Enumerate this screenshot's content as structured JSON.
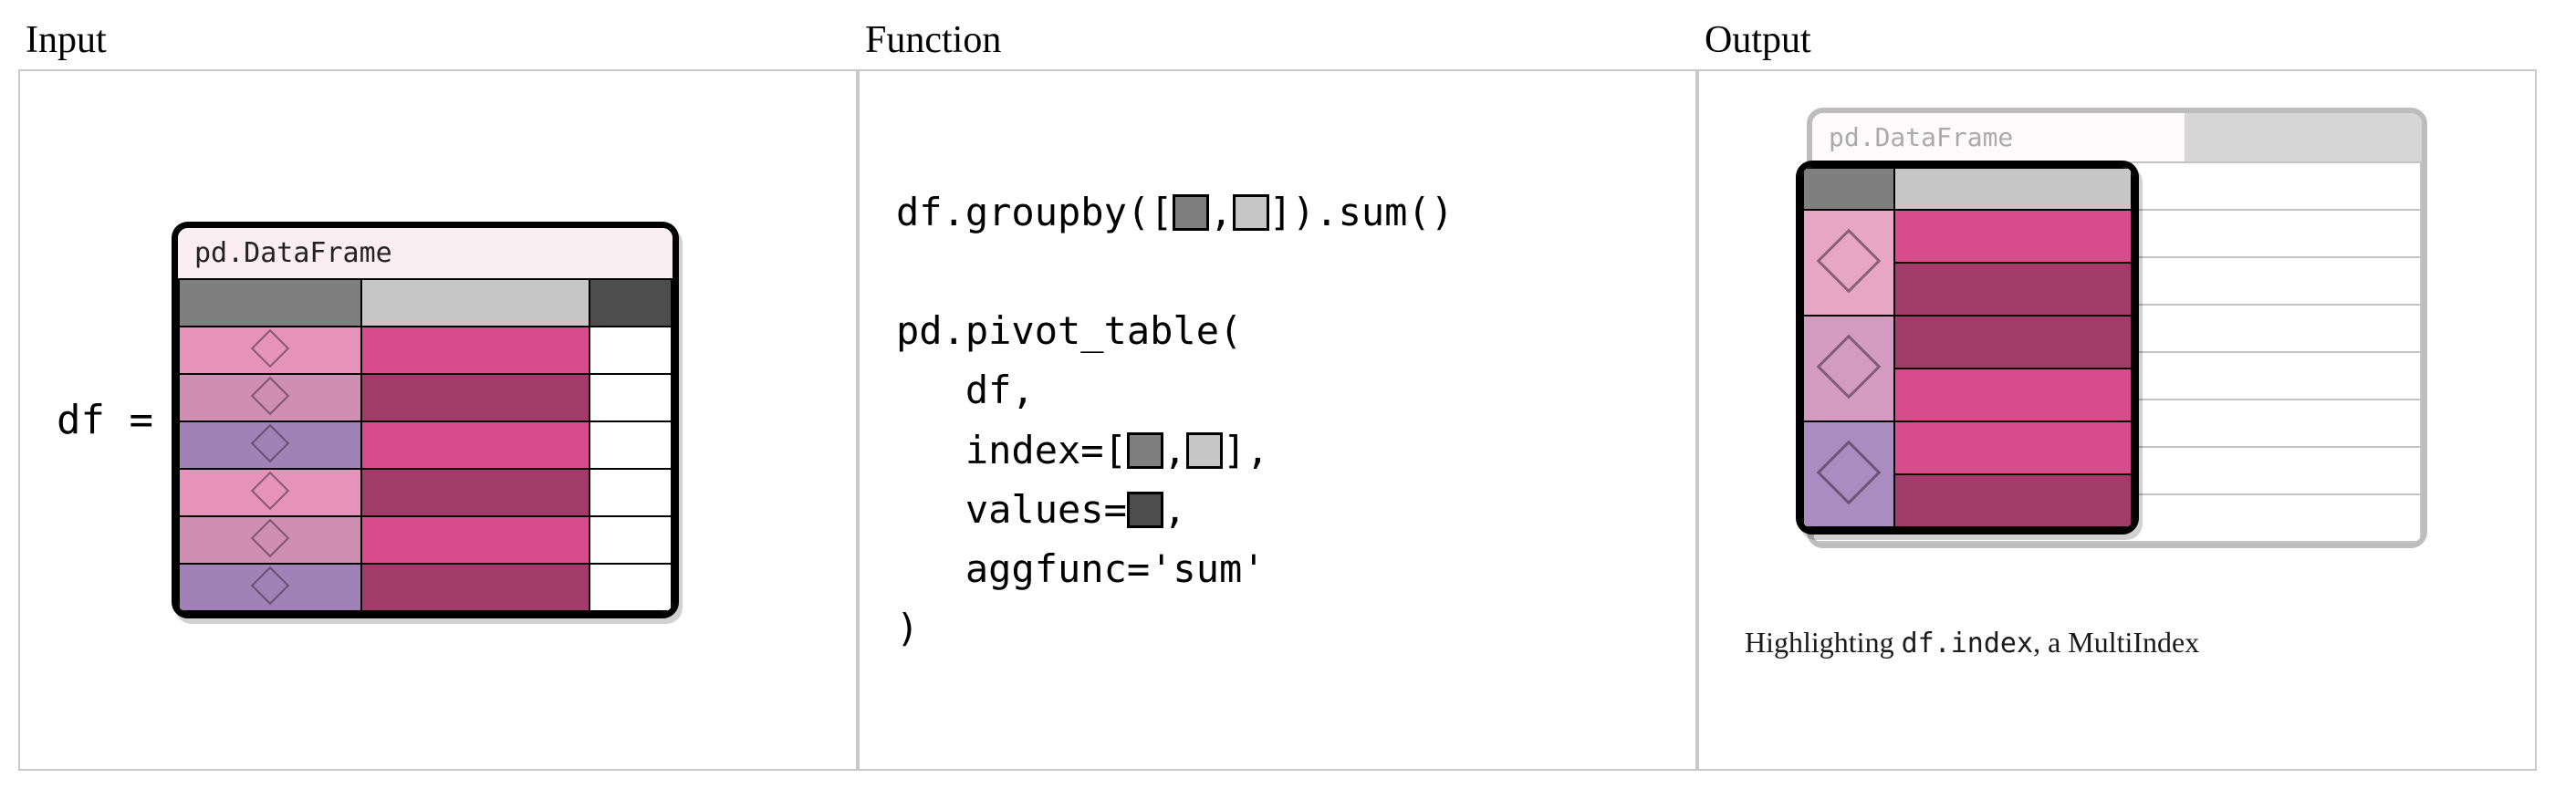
{
  "panels": {
    "input": {
      "label": "Input"
    },
    "function": {
      "label": "Function"
    },
    "output": {
      "label": "Output"
    }
  },
  "input": {
    "assign": "df =",
    "df_title": "pd.DataFrame",
    "header_colors": [
      "#7f7f7f",
      "#c6c6c6",
      "#4d4d4d"
    ],
    "rows": [
      {
        "index_color": "#e693bb",
        "value_color": "#d94c8b"
      },
      {
        "index_color": "#cf8fb3",
        "value_color": "#a23b6a"
      },
      {
        "index_color": "#a082b7",
        "value_color": "#d94c8b"
      },
      {
        "index_color": "#e693bb",
        "value_color": "#a23b6a"
      },
      {
        "index_color": "#cf8fb3",
        "value_color": "#d94c8b"
      },
      {
        "index_color": "#a082b7",
        "value_color": "#a23b6a"
      }
    ]
  },
  "function": {
    "line1_a": "df.groupby([",
    "line1_b": ",",
    "line1_c": "]).sum()",
    "pivot_open": "pd.pivot_table(",
    "arg_df": "   df,",
    "arg_index_a": "   index=[",
    "arg_index_b": ",",
    "arg_index_c": "],",
    "arg_values_a": "   values=",
    "arg_values_b": ",",
    "arg_aggfunc": "   aggfunc='sum'",
    "close": ")",
    "squares": {
      "dark": "#7f7f7f",
      "light": "#c6c6c6",
      "dgrey": "#4d4d4d"
    }
  },
  "output": {
    "ghost_title": "pd.DataFrame",
    "ghost_rows": 7,
    "overlay": {
      "header_colors": [
        "#7f7f7f",
        "#c6c6c6"
      ],
      "groups": [
        {
          "index_color": "#e6a6c4",
          "values": [
            "#d94c8b",
            "#a23b6a"
          ]
        },
        {
          "index_color": "#d39bbf",
          "values": [
            "#a23b6a",
            "#d94c8b"
          ]
        },
        {
          "index_color": "#ab8cc0",
          "values": [
            "#d94c8b",
            "#a23b6a"
          ]
        }
      ]
    },
    "caption_a": "Highlighting ",
    "caption_code": "df.index",
    "caption_b": ", a MultiIndex"
  }
}
